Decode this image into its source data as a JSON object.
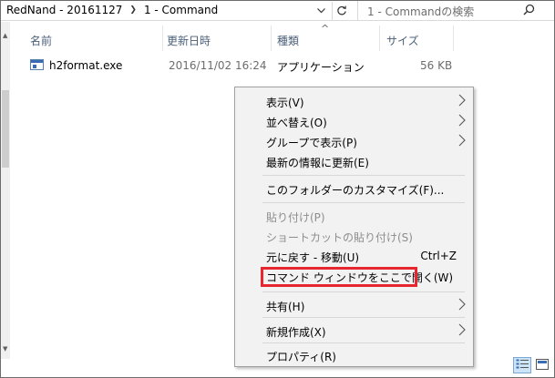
{
  "breadcrumb": [
    "RedNand - 20161127",
    "1 - Command"
  ],
  "search": {
    "placeholder": "1 - Commandの検索"
  },
  "icons": {
    "breadcrumb_separator": "chevron-right-icon",
    "address_dropdown": "chevron-down-icon",
    "refresh": "refresh-icon",
    "search": "search-icon",
    "submenu_arrow": "chevron-right-icon",
    "file": "application-icon"
  },
  "columns": {
    "name": "名前",
    "modified": "更新日時",
    "type": "種類",
    "size": "サイズ"
  },
  "files": [
    {
      "name": "h2format.exe",
      "modified": "2016/11/02 16:24",
      "type": "アプリケーション",
      "size": "56 KB"
    }
  ],
  "context_menu": {
    "view": "表示(V)",
    "sort_by": "並べ替え(O)",
    "group_by": "グループで表示(P)",
    "refresh": "最新の情報に更新(E)",
    "customize": "このフォルダーのカスタマイズ(F)...",
    "paste": "貼り付け(P)",
    "paste_shortcut": "ショートカットの貼り付け(S)",
    "undo_move": "元に戻す - 移動(U)",
    "undo_shortcut": "Ctrl+Z",
    "open_cmd": "コマンド ウィンドウをここで開く(W)",
    "share": "共有(H)",
    "new": "新規作成(X)",
    "properties": "プロパティ(R)"
  },
  "colors": {
    "highlight_border": "#e8262f",
    "menu_background": "#f2f2f2",
    "column_header_text": "#4c607a",
    "disabled_text": "#8d8d8d"
  }
}
